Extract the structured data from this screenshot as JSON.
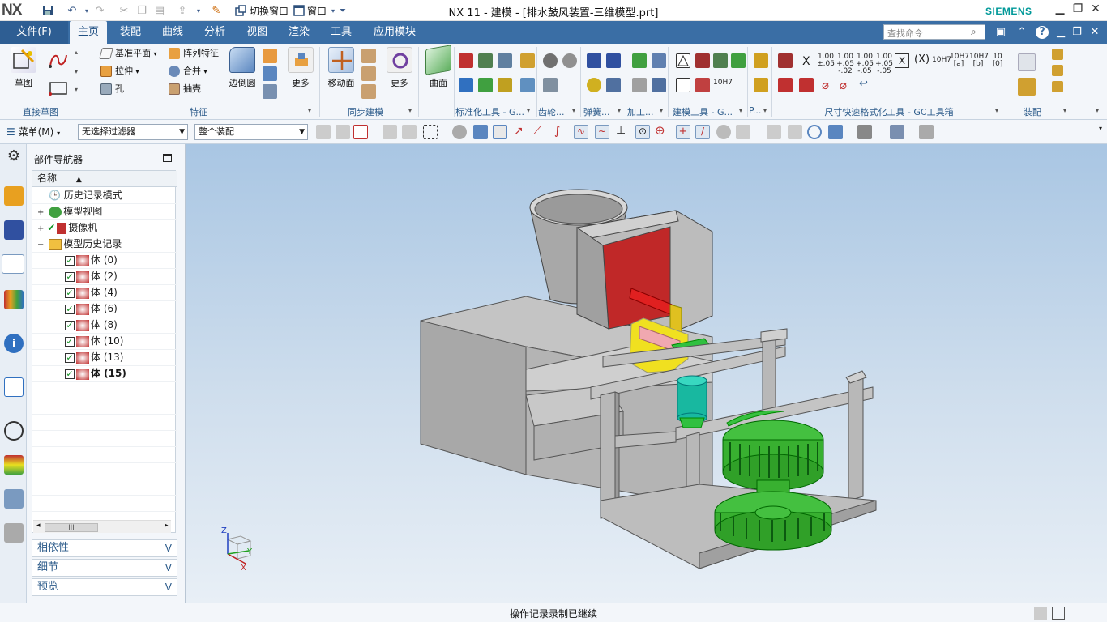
{
  "title_bar": {
    "logo": "NX",
    "switch_window": "切换窗口",
    "window_menu": "窗口",
    "title": "NX 11 - 建模 - [排水鼓风装置-三维模型.prt]",
    "brand": "SIEMENS"
  },
  "ribbon_tabs": {
    "file": "文件(F)",
    "items": [
      "主页",
      "装配",
      "曲线",
      "分析",
      "视图",
      "渲染",
      "工具",
      "应用模块"
    ],
    "active": "主页",
    "search_placeholder": "查找命令"
  },
  "ribbon": {
    "direct_sketch": {
      "sketch": "草图",
      "label": "直接草图"
    },
    "feature": {
      "datum_plane": "基准平面",
      "pattern": "阵列特征",
      "extrude": "拉伸",
      "unite": "合并",
      "hole": "孔",
      "shell": "抽壳",
      "edge_blend": "边倒圆",
      "more": "更多",
      "label": "特征"
    },
    "sync": {
      "move_face": "移动面",
      "more": "更多",
      "label": "同步建模"
    },
    "surface": {
      "label": "曲面"
    },
    "groups": {
      "standard_tools": "标准化工具 - G...",
      "gear": "齿轮...",
      "spring": "弹簧...",
      "machining": "加工...",
      "modeling_tools": "建模工具 - G...",
      "p": "P...",
      "dim_format": "尺寸快速格式化工具 - GC工具箱",
      "assembly": "装配"
    },
    "gc_labels": [
      "1.00\n±.05",
      "1.00\n+.05\n-.02",
      "1.00\n+.05\n-.05",
      "1.00\n+.05\n-.05",
      "10H7",
      "10H7\n[a]",
      "10H7\n[b]",
      "10\n[0]"
    ]
  },
  "toolbar2": {
    "menu": "菜单(M)",
    "filter": "无选择过滤器",
    "scope": "整个装配"
  },
  "navigator": {
    "title": "部件导航器",
    "column_name": "名称",
    "items": [
      {
        "label": "历史记录模式",
        "type": "history-mode"
      },
      {
        "label": "模型视图",
        "type": "model-views"
      },
      {
        "label": "摄像机",
        "type": "cameras"
      },
      {
        "label": "模型历史记录",
        "type": "model-history"
      }
    ],
    "bodies": [
      "体 (0)",
      "体 (2)",
      "体 (4)",
      "体 (6)",
      "体 (8)",
      "体 (10)",
      "体 (13)",
      "体 (15)"
    ],
    "panels": [
      "相依性",
      "细节",
      "预览"
    ]
  },
  "triad": {
    "z": "Z",
    "y": "Y",
    "x": "X"
  },
  "status": {
    "text": "操作记录录制已继续"
  },
  "colors": {
    "tab_bar": "#3a6ea5",
    "ribbon_bg": "#f3f6fa",
    "viewport_top": "#a9c6e3",
    "model_gray": "#b5b5b5",
    "model_red": "#c0302c",
    "model_yellow": "#f0e020",
    "model_green": "#33c03a",
    "model_cyan": "#18b8a0"
  }
}
